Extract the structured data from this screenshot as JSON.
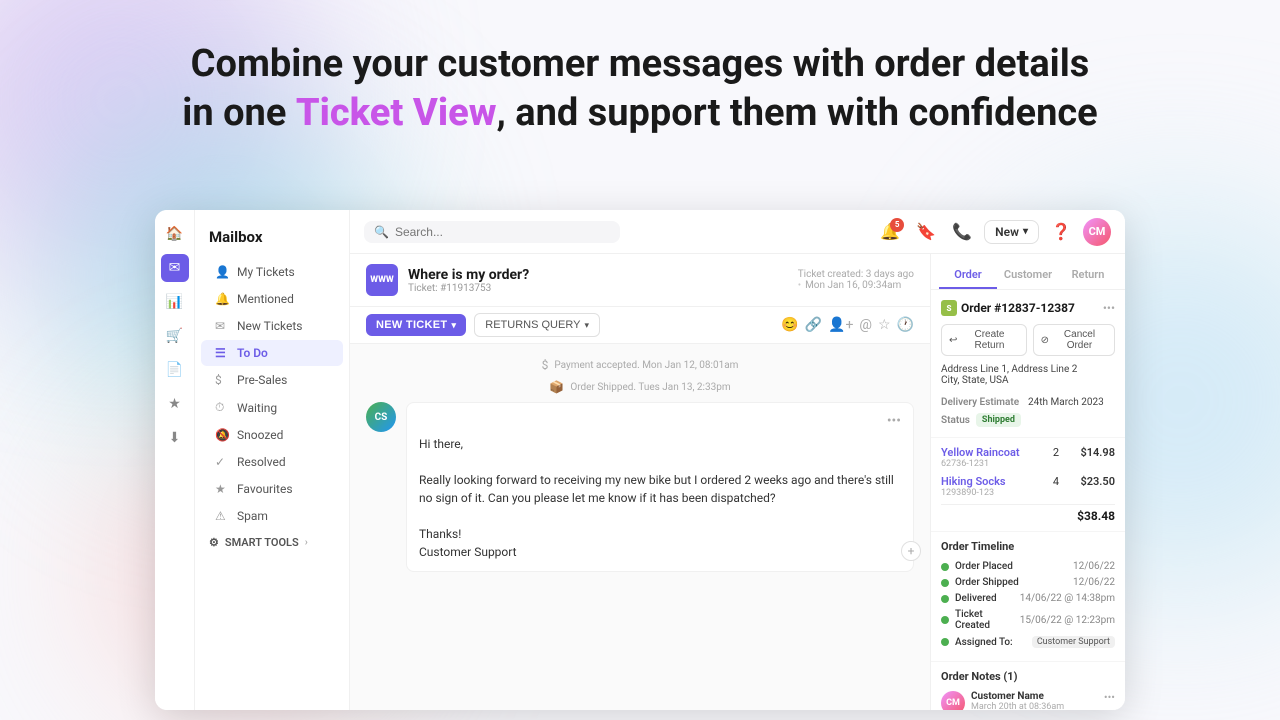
{
  "hero": {
    "line1": "Combine your customer messages with order details",
    "line2_prefix": "in one ",
    "line2_highlight": "Ticket View",
    "line2_suffix": ", and support them with confidence"
  },
  "sidebar": {
    "title": "Mailbox",
    "nav_items": [
      {
        "id": "my-tickets",
        "label": "My Tickets",
        "icon": "👤"
      },
      {
        "id": "mentioned",
        "label": "Mentioned",
        "icon": "🔔"
      },
      {
        "id": "new-tickets",
        "label": "New Tickets",
        "icon": "✉"
      },
      {
        "id": "to-do",
        "label": "To Do",
        "icon": "☰",
        "active": true
      },
      {
        "id": "pre-sales",
        "label": "Pre-Sales",
        "icon": "$"
      },
      {
        "id": "waiting",
        "label": "Waiting",
        "icon": "⏱"
      },
      {
        "id": "snoozed",
        "label": "Snoozed",
        "icon": "🔕"
      },
      {
        "id": "resolved",
        "label": "Resolved",
        "icon": "✓"
      },
      {
        "id": "favourites",
        "label": "Favourites",
        "icon": "★"
      },
      {
        "id": "spam",
        "label": "Spam",
        "icon": "⚠"
      }
    ],
    "smart_tools": "SMART TOOLS"
  },
  "topbar": {
    "search_placeholder": "Search...",
    "notif_count": "5",
    "new_button": "New",
    "avatar_initials": "CM"
  },
  "ticket": {
    "www_badge": "WWW",
    "title": "Where is my order?",
    "ticket_number": "Ticket: #11913753",
    "created_info": "Ticket created: 3 days ago",
    "date": "Mon Jan 16, 09:34am",
    "new_ticket_btn": "NEW TICKET",
    "returns_query_btn": "RETURNS QUERY",
    "messages": [
      {
        "type": "system",
        "icon": "$",
        "text": "Payment accepted. Mon Jan 12, 08:01am"
      },
      {
        "type": "system",
        "icon": "📦",
        "text": "Order Shipped. Tues Jan 13, 2:33pm"
      },
      {
        "type": "message",
        "avatar": "CS",
        "avatar_bg": "#4CAF50",
        "greeting": "Hi there,",
        "body": "Really looking forward to receiving my new bike but I ordered 2 weeks ago and there's still no sign of it. Can you please let me know if it has been dispatched?",
        "sign_off": "Thanks!",
        "signature": "Customer Support"
      }
    ]
  },
  "right_panel": {
    "tabs": [
      "Order",
      "Customer",
      "Return"
    ],
    "active_tab": "Order",
    "order_id": "Order #12837-12387",
    "actions": [
      {
        "label": "Create Return",
        "icon": "↩"
      },
      {
        "label": "Cancel Order",
        "icon": "⊘"
      }
    ],
    "address": {
      "line1": "Address Line 1, Address Line 2",
      "line2": "City, State, USA"
    },
    "delivery_estimate": "24th March 2023",
    "status": "Shipped",
    "items": [
      {
        "name": "Yellow Raincoat",
        "sku": "62736-1231",
        "qty": "2",
        "price": "$14.98"
      },
      {
        "name": "Hiking Socks",
        "sku": "1293890-123",
        "qty": "4",
        "price": "$23.50"
      }
    ],
    "total": "$38.48",
    "timeline_title": "Order Timeline",
    "timeline": [
      {
        "label": "Order Placed",
        "value": "12/06/22",
        "color": "#4CAF50"
      },
      {
        "label": "Order Shipped",
        "value": "12/06/22",
        "color": "#4CAF50"
      },
      {
        "label": "Delivered",
        "value": "14/06/22 @ 14:38pm",
        "color": "#4CAF50"
      },
      {
        "label": "Ticket Created",
        "value": "15/06/22 @ 12:23pm",
        "color": "#4CAF50"
      },
      {
        "label": "Assigned To:",
        "value": "Customer Support",
        "color": "#4CAF50",
        "is_badge": true
      }
    ],
    "notes_title": "Order Notes (1)",
    "note": {
      "name": "Customer Name",
      "date": "March 20th at 08:36am",
      "avatar_initials": "CM"
    }
  }
}
